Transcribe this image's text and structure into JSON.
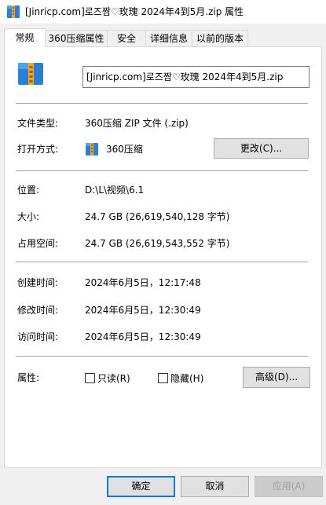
{
  "window": {
    "title": "[Jinricp.com]로즈짬♡玫瑰 2024年4到5月.zip 属性"
  },
  "tabs": [
    {
      "label": "常规",
      "active": true
    },
    {
      "label": "360压缩属性",
      "active": false
    },
    {
      "label": "安全",
      "active": false
    },
    {
      "label": "详细信息",
      "active": false
    },
    {
      "label": "以前的版本",
      "active": false
    }
  ],
  "general": {
    "file_name": "[Jinricp.com]로즈짬♡玫瑰 2024年4到5月.zip",
    "file_type_label": "文件类型:",
    "file_type_value": "360压缩 ZIP 文件 (.zip)",
    "open_with_label": "打开方式:",
    "open_with_value": "360压缩",
    "change_button": "更改(C)...",
    "location_label": "位置:",
    "location_value": "D:\\L\\视频\\6.1",
    "size_label": "大小:",
    "size_value": "24.7 GB (26,619,540,128 字节)",
    "size_on_disk_label": "占用空间:",
    "size_on_disk_value": "24.7 GB (26,619,543,552 字节)",
    "created_label": "创建时间:",
    "created_value": "2024年6月5日，12:17:48",
    "modified_label": "修改时间:",
    "modified_value": "2024年6月5日，12:30:49",
    "accessed_label": "访问时间:",
    "accessed_value": "2024年6月5日，12:30:49",
    "attributes_label": "属性:",
    "readonly_label": "只读(R)",
    "hidden_label": "隐藏(H)",
    "advanced_button": "高级(D)..."
  },
  "footer": {
    "ok": "确定",
    "cancel": "取消",
    "apply": "应用(A)"
  },
  "icons": {
    "zip": "zip-archive-icon"
  },
  "colors": {
    "accent": "#0078d7",
    "zip_blue": "#2a7fd4",
    "zip_orange": "#f4a623"
  }
}
